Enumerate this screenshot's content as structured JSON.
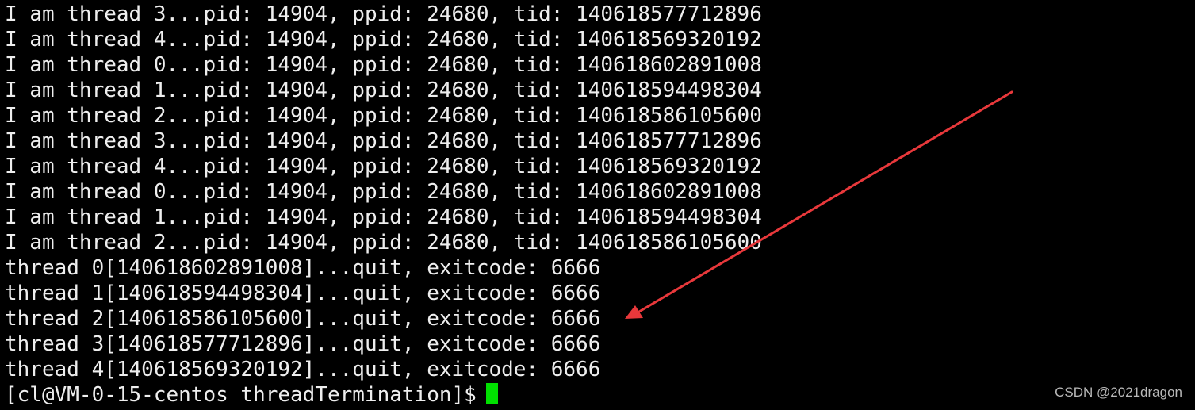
{
  "terminal": {
    "lines": [
      "I am thread 3...pid: 14904, ppid: 24680, tid: 140618577712896",
      "I am thread 4...pid: 14904, ppid: 24680, tid: 140618569320192",
      "I am thread 0...pid: 14904, ppid: 24680, tid: 140618602891008",
      "I am thread 1...pid: 14904, ppid: 24680, tid: 140618594498304",
      "I am thread 2...pid: 14904, ppid: 24680, tid: 140618586105600",
      "I am thread 3...pid: 14904, ppid: 24680, tid: 140618577712896",
      "I am thread 4...pid: 14904, ppid: 24680, tid: 140618569320192",
      "I am thread 0...pid: 14904, ppid: 24680, tid: 140618602891008",
      "I am thread 1...pid: 14904, ppid: 24680, tid: 140618594498304",
      "I am thread 2...pid: 14904, ppid: 24680, tid: 140618586105600",
      "thread 0[140618602891008]...quit, exitcode: 6666",
      "thread 1[140618594498304]...quit, exitcode: 6666",
      "thread 2[140618586105600]...quit, exitcode: 6666",
      "thread 3[140618577712896]...quit, exitcode: 6666",
      "thread 4[140618569320192]...quit, exitcode: 6666"
    ],
    "prompt": "[cl@VM-0-15-centos threadTermination]$",
    "text_color": "#eeeeee",
    "background_color": "#000000",
    "cursor_color": "#00e000"
  },
  "annotation": {
    "arrow_color": "#e8383b"
  },
  "watermark": "CSDN @2021dragon"
}
